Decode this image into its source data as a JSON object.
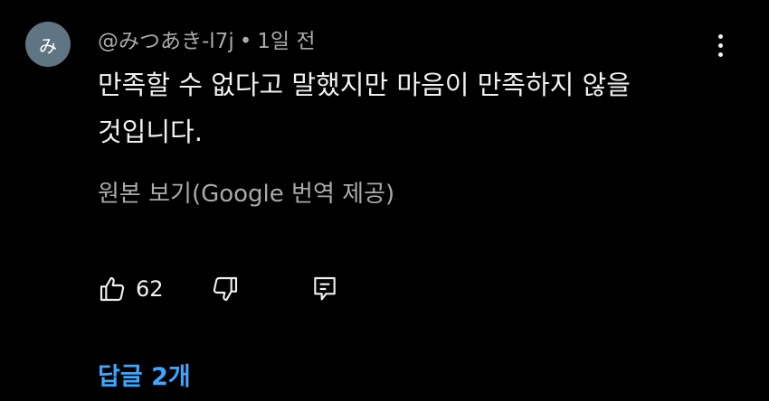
{
  "comment": {
    "avatar_initial": "み",
    "author": "@みつあき-l7j",
    "separator": "•",
    "timestamp": "1일 전",
    "text": "만족할 수 없다고 말했지만 마음이 만족하지 않을 것입니다.",
    "translate_link": "원본 보기(Google 번역 제공)",
    "like_count": "62",
    "replies_label": "답글 2개"
  },
  "icons": {
    "more": "more-vert-icon",
    "like": "thumbs-up-icon",
    "dislike": "thumbs-down-icon",
    "reply": "reply-comment-icon"
  },
  "colors": {
    "background": "#000000",
    "avatar_bg": "#5f7584",
    "text_primary": "#f1f1f1",
    "text_secondary": "#aaaaaa",
    "link_blue": "#3ea6ff"
  }
}
